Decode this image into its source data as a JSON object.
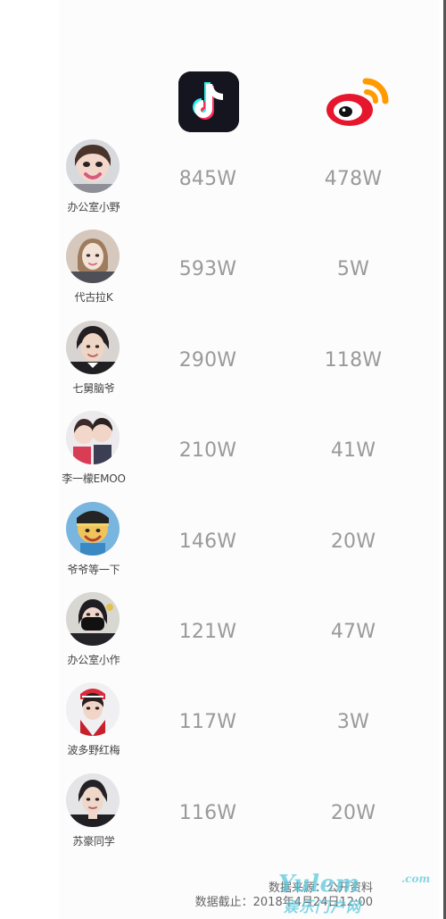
{
  "platforms": {
    "douyin": {
      "icon": "douyin-tiktok-icon",
      "colors": {
        "background": "#151520",
        "cyan": "#25f4ee",
        "red": "#fe2c55",
        "white": "#ffffff"
      }
    },
    "weibo": {
      "icon": "weibo-icon",
      "colors": {
        "red": "#e6162d",
        "orange": "#ff9a00",
        "black": "#111111",
        "white": "#ffffff"
      }
    }
  },
  "rows": [
    {
      "name": "办公室小野",
      "douyin": "845W",
      "weibo": "478W",
      "avatar": "avatar-icon"
    },
    {
      "name": "代古拉K",
      "douyin": "593W",
      "weibo": "5W",
      "avatar": "avatar-icon"
    },
    {
      "name": "七舅脑爷",
      "douyin": "290W",
      "weibo": "118W",
      "avatar": "avatar-icon"
    },
    {
      "name": "李一檬EMOO",
      "douyin": "210W",
      "weibo": "41W",
      "avatar": "avatar-icon"
    },
    {
      "name": "爷爷等一下",
      "douyin": "146W",
      "weibo": "20W",
      "avatar": "avatar-icon"
    },
    {
      "name": "办公室小作",
      "douyin": "121W",
      "weibo": "47W",
      "avatar": "avatar-icon"
    },
    {
      "name": "波多野红梅",
      "douyin": "117W",
      "weibo": "3W",
      "avatar": "avatar-icon"
    },
    {
      "name": "苏豪同学",
      "douyin": "116W",
      "weibo": "20W",
      "avatar": "avatar-icon"
    }
  ],
  "footer": {
    "source": "数据来源：公开资料",
    "cutoff": "数据截止：2018年4月24日12:00"
  },
  "watermark": {
    "main": "Yulem",
    "suffix": ".com",
    "sub": "娱乐门户网"
  }
}
